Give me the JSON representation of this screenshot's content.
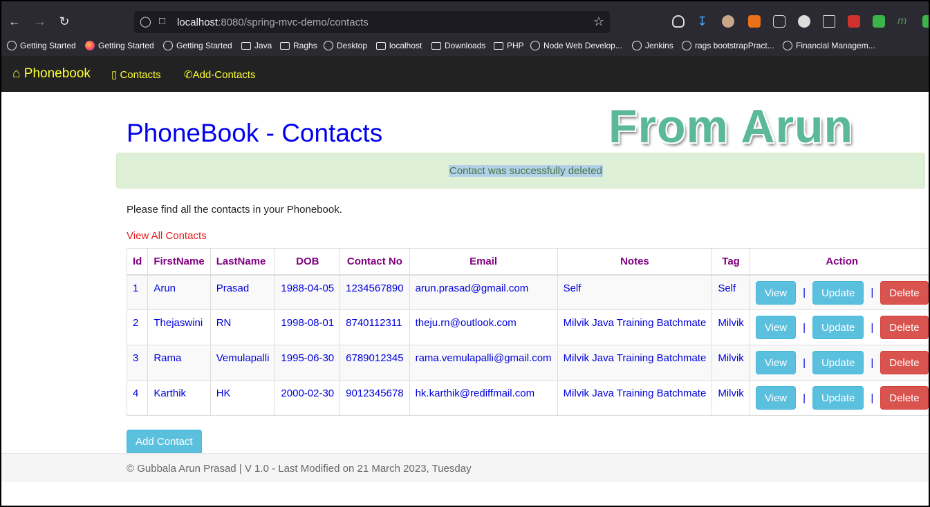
{
  "browser": {
    "url_host": "localhost",
    "url_path": ":8080/spring-mvc-demo/contacts",
    "bookmarks": [
      {
        "label": "Getting Started",
        "icon": "globe-icon"
      },
      {
        "label": "Getting Started",
        "icon": "firefox-icon"
      },
      {
        "label": "Getting Started",
        "icon": "globe-icon"
      },
      {
        "label": "Java",
        "icon": "folder-icon"
      },
      {
        "label": "Raghs",
        "icon": "folder-icon"
      },
      {
        "label": "Desktop",
        "icon": "globe-icon"
      },
      {
        "label": "localhost",
        "icon": "folder-icon"
      },
      {
        "label": "Downloads",
        "icon": "folder-icon"
      },
      {
        "label": "PHP",
        "icon": "folder-icon"
      },
      {
        "label": "Node Web Develop...",
        "icon": "globe-icon"
      },
      {
        "label": "Jenkins",
        "icon": "globe-icon"
      },
      {
        "label": "rags bootstrapPract...",
        "icon": "globe-icon"
      },
      {
        "label": "Financial Managem...",
        "icon": "globe-icon"
      }
    ]
  },
  "navbar": {
    "brand": "Phonebook",
    "links": [
      "Contacts",
      "Add-Contacts"
    ],
    "brand_color": "#ffff33"
  },
  "page": {
    "title": "PhoneBook - Contacts",
    "watermark": "From Arun",
    "alert": "Contact was successfully deleted",
    "intro": "Please find all the contacts in your Phonebook.",
    "view_all": "View All Contacts",
    "add_button": "Add Contact"
  },
  "table": {
    "headers": [
      "Id",
      "FirstName",
      "LastName",
      "DOB",
      "Contact No",
      "Email",
      "Notes",
      "Tag",
      "Action"
    ],
    "rows": [
      [
        "1",
        "Arun",
        "Prasad",
        "1988-04-05",
        "1234567890",
        "arun.prasad@gmail.com",
        "Self",
        "Self"
      ],
      [
        "2",
        "Thejaswini",
        "RN",
        "1998-08-01",
        "8740112311",
        "theju.rn@outlook.com",
        "Milvik Java Training Batchmate",
        "Milvik"
      ],
      [
        "3",
        "Rama",
        "Vemulapalli",
        "1995-06-30",
        "6789012345",
        "rama.vemulapalli@gmail.com",
        "Milvik Java Training Batchmate",
        "Milvik"
      ],
      [
        "4",
        "Karthik",
        "HK",
        "2000-02-30",
        "9012345678",
        "hk.karthik@rediffmail.com",
        "Milvik Java Training Batchmate",
        "Milvik"
      ]
    ],
    "actions": {
      "view": "View",
      "update": "Update",
      "delete": "Delete",
      "separator": "|"
    }
  },
  "footer": {
    "text": "© Gubbala Arun Prasad | V 1.0 - Last Modified on 21 March 2023, Tuesday"
  }
}
